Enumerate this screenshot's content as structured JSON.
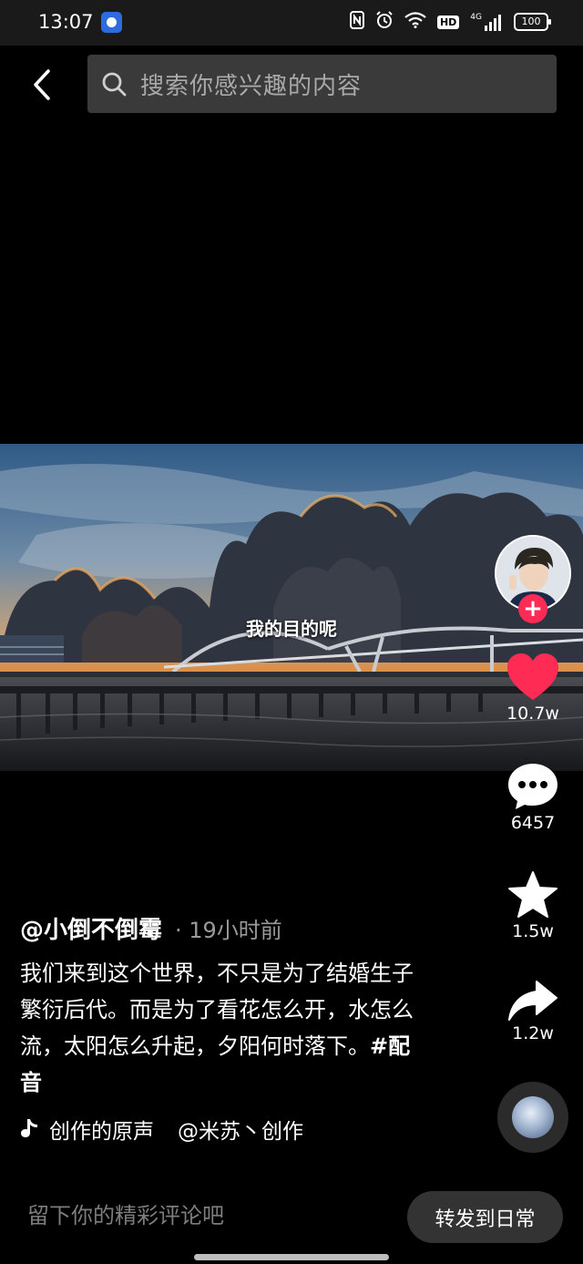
{
  "status_bar": {
    "time": "13:07",
    "network": "4G",
    "hd_label": "HD",
    "battery": "100",
    "icons": [
      "app-notification-icon",
      "nfc-icon",
      "alarm-icon",
      "wifi-icon",
      "signal-icon",
      "battery-icon"
    ]
  },
  "header": {
    "back_icon": "chevron-left-icon",
    "search_icon": "search-icon",
    "search_placeholder": "搜索你感兴趣的内容"
  },
  "video": {
    "subtitle": "我的目的呢"
  },
  "actions": {
    "follow_icon": "plus-icon",
    "like_icon": "heart-icon",
    "like_count": "10.7w",
    "comment_icon": "comment-bubble-icon",
    "comment_count": "6457",
    "favorite_icon": "star-icon",
    "favorite_count": "1.5w",
    "share_icon": "share-arrow-icon",
    "share_count": "1.2w",
    "music_icon": "music-disc-icon"
  },
  "post": {
    "author": "@小倒不倒霉",
    "time": "· 19小时前",
    "caption": "我们来到这个世界，不只是为了结婚生子繁衍后代。而是为了看花怎么开，水怎么流，太阳怎么升起，夕阳何时落下。",
    "hashtag": "#配音",
    "music_icon": "tiktok-note-icon",
    "music_title": "创作的原声",
    "music_creator": "@米苏丶创作"
  },
  "comment_bar": {
    "placeholder": "留下你的精彩评论吧",
    "repost_label": "转发到日常"
  },
  "colors": {
    "like_red": "#fe2c55",
    "background": "#000000",
    "search_bg": "#3a3a3a",
    "repost_bg": "#333333"
  }
}
